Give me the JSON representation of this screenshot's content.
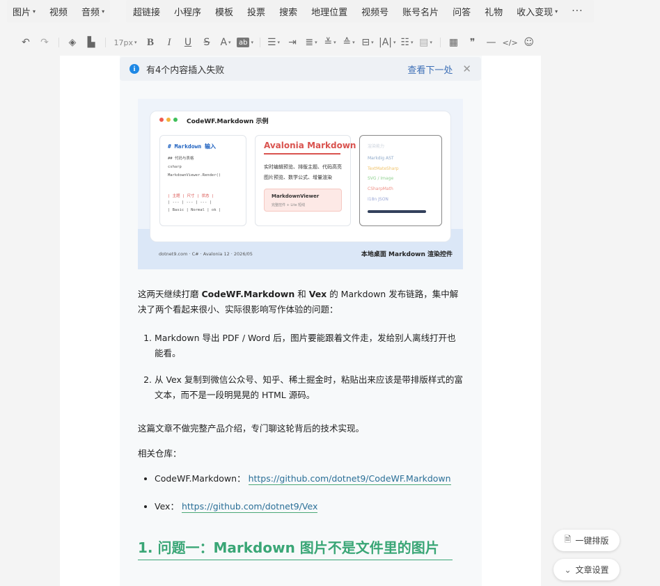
{
  "top_toolbar": {
    "group1": [
      {
        "label": "图片",
        "has_caret": true
      },
      {
        "label": "视频",
        "has_caret": false
      },
      {
        "label": "音频",
        "has_caret": true
      }
    ],
    "group2": [
      {
        "label": "超链接",
        "has_caret": false
      },
      {
        "label": "小程序",
        "has_caret": false
      },
      {
        "label": "模板",
        "has_caret": false
      },
      {
        "label": "投票",
        "has_caret": false
      },
      {
        "label": "搜索",
        "has_caret": false
      },
      {
        "label": "地理位置",
        "has_caret": false
      },
      {
        "label": "视频号",
        "has_caret": false
      },
      {
        "label": "账号名片",
        "has_caret": false
      },
      {
        "label": "问答",
        "has_caret": false
      },
      {
        "label": "礼物",
        "has_caret": false
      },
      {
        "label": "收入变现",
        "has_caret": true
      }
    ],
    "more_label": "···"
  },
  "format_toolbar": {
    "font_size": "17px",
    "bg_tag": "ab"
  },
  "notice": {
    "message": "有4个内容插入失败",
    "next_link": "查看下一处",
    "close_glyph": "✕"
  },
  "cover": {
    "window_title": "CodeWF.Markdown 示例",
    "pane1": {
      "heading": "# Markdown 输入",
      "lines": [
        "## 代码与表格",
        "  csharp",
        "MarkdownViewer.Render()"
      ],
      "table_lines": [
        "| 主题 | 尺寸 | 状态 |",
        "| --- | --- | --- |",
        "| Basic | Normal | ok |"
      ]
    },
    "pane2": {
      "title": "Avalonia Markdown",
      "desc1": "实时编辑预览、排版主题、代码高亮",
      "desc2": "图片预览、数学公式、增量渲染",
      "card_title": "MarkdownViewer",
      "card_sub": "完整控件 + Lite 短线"
    },
    "pane3": {
      "caption": "渲染能力",
      "items": [
        {
          "text": "Markdig AST",
          "color": "#8fa9c9"
        },
        {
          "text": "TextMateSharp",
          "color": "#f0c36b"
        },
        {
          "text": "SVG / Image",
          "color": "#8fd08f"
        },
        {
          "text": "CSharpMath",
          "color": "#ef8f85"
        },
        {
          "text": "I18n JSON",
          "color": "#9aa7d6"
        }
      ]
    },
    "footer_left": "dotnet9.com · C# · Avalonia 12 · 2026/05",
    "footer_right": "本地桌面 Markdown 渲染控件"
  },
  "article": {
    "intro_prefix": "这两天继续打磨 ",
    "intro_bold1": "CodeWF.Markdown",
    "intro_mid": " 和 ",
    "intro_bold2": "Vex",
    "intro_suffix": " 的 Markdown 发布链路，集中解决了两个看起来很小、实际很影响写作体验的问题：",
    "problems": [
      "Markdown 导出 PDF / Word 后，图片要能跟着文件走，发给别人离线打开也能看。",
      "从 Vex 复制到微信公众号、知乎、稀土掘金时，粘贴出来应该是带排版样式的富文本，而不是一段明晃晃的 HTML 源码。"
    ],
    "para2": "这篇文章不做完整产品介绍，专门聊这轮背后的技术实现。",
    "repos_label": "相关仓库：",
    "repos": [
      {
        "name": "CodeWF.Markdown：",
        "url": "https://github.com/dotnet9/CodeWF.Markdown"
      },
      {
        "name": "Vex：",
        "url": "https://github.com/dotnet9/Vex"
      }
    ],
    "heading1": "1. 问题一：Markdown 图片不是文件里的图片"
  },
  "float_buttons": {
    "format_label": "一键排版",
    "settings_label": "文章设置"
  },
  "colors": {
    "accent_green": "#3aa676",
    "link_blue": "#3d6fb6",
    "info_blue": "#1e88e5",
    "brand_red": "#d9534f"
  }
}
